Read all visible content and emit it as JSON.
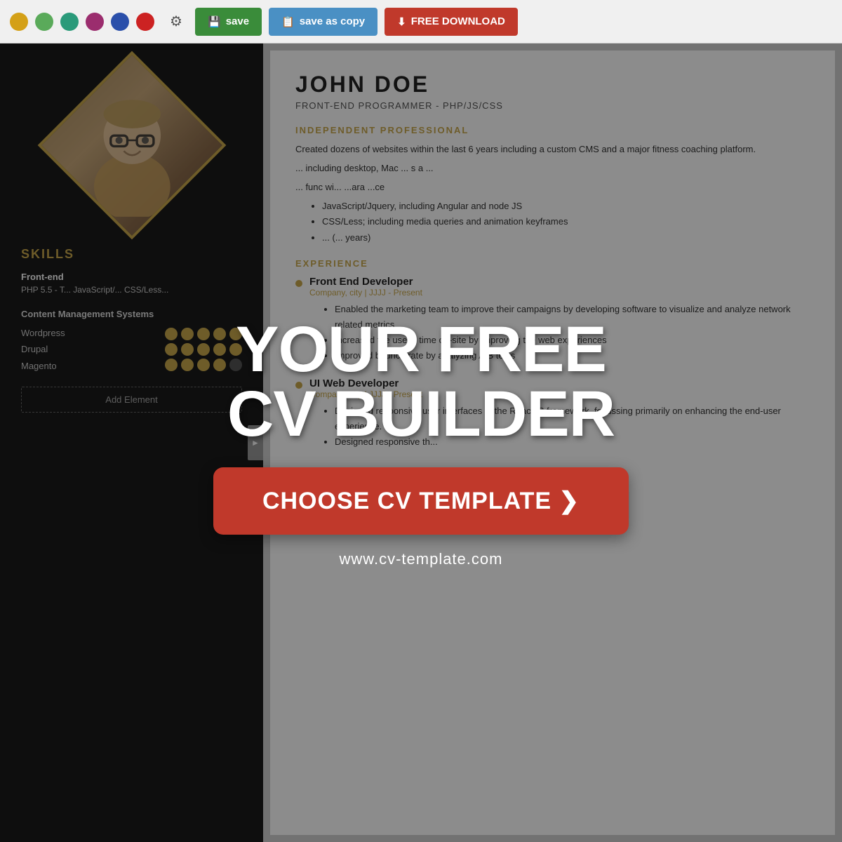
{
  "toolbar": {
    "save_label": "save",
    "save_copy_label": "save as copy",
    "download_label": "FREE DOWNLOAD",
    "colors": [
      {
        "name": "yellow",
        "hex": "#d4a017"
      },
      {
        "name": "green",
        "hex": "#5aaa5a"
      },
      {
        "name": "teal",
        "hex": "#2a9a7a"
      },
      {
        "name": "purple",
        "hex": "#9b2d6e"
      },
      {
        "name": "blue",
        "hex": "#2a4faa"
      },
      {
        "name": "red",
        "hex": "#cc2222"
      }
    ]
  },
  "left_panel": {
    "skills_heading": "SKILLS",
    "frontend_label": "Front-end",
    "frontend_skills": "PHP 5.5 - T...\nJavaScript/...\nCSS/Less...",
    "cms_heading": "Content Management Systems",
    "cms_items": [
      "Wordpress",
      "Drupal",
      "Magento"
    ],
    "add_element_label": "Add Element"
  },
  "right_panel": {
    "name": "JOHN  DOE",
    "job_title": "FRONT-END PROGRAMMER - PHP/JS/CSS",
    "professional_section": "INDEPENDENT PROFESSIONAL",
    "professional_body": "Created dozens of websites within the last 6 years including a custom CMS and a major fitness coaching platform.",
    "professional_line2": "... including desktop, Mac ... s a ...",
    "skills_list": [
      "JavaScript/Jquery, including Angular and node JS",
      "CSS/Less; including media queries and animation keyframes",
      "... (... years)"
    ],
    "experience_heading": "EXPERIENCE",
    "experience_items": [
      {
        "title": "Front End Developer",
        "company": "Company, city | JJJJ - Present",
        "bullets": [
          "Enabled the marketing team to improve their campaigns by developing software to visualize and analyze network related metrics",
          "Increased the users' time on-site by improving the web experiences",
          "Improved bounce rate by analyzing A/B tests"
        ]
      },
      {
        "title": "UI Web Developer",
        "company": "Company, city | JJJJ - Present",
        "bullets": [
          "Designed responsive user interfaces in the ReactJS framework, focussing primarily on enhancing the end-user experience.",
          "Designed responsive th..."
        ]
      }
    ]
  },
  "overlay": {
    "headline_line1": "YOUR FREE",
    "headline_line2": "CV BUILDER",
    "cta_label": "CHOOSE CV TEMPLATE ❯",
    "url": "www.cv-template.com"
  }
}
